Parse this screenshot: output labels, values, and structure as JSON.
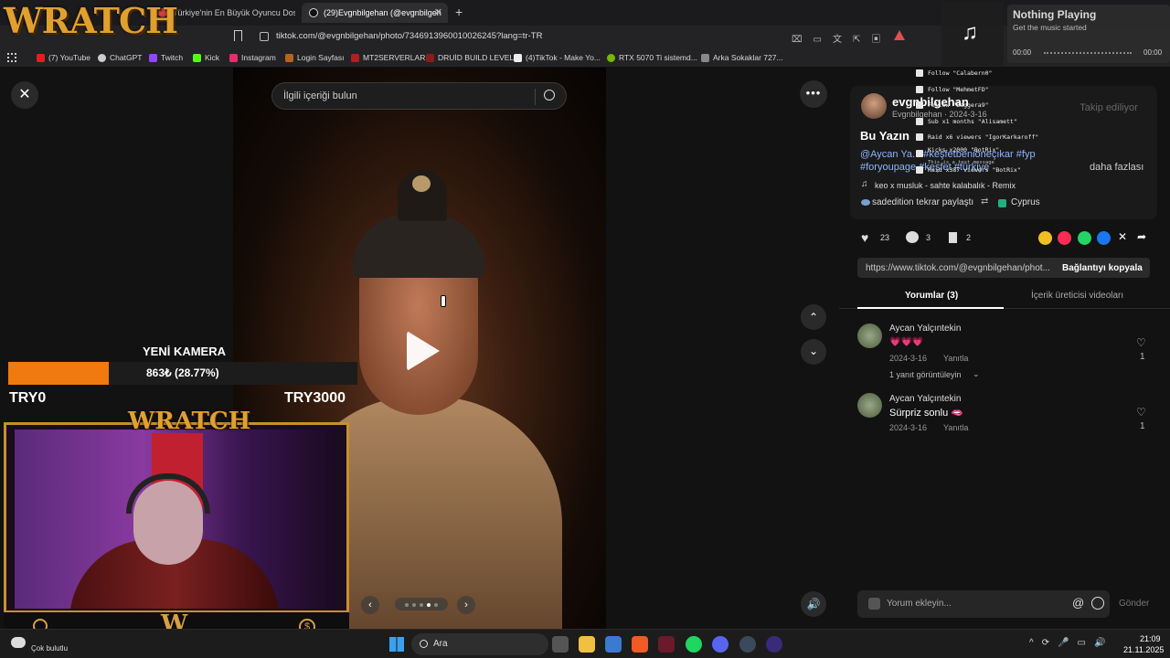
{
  "browser": {
    "tabs": [
      {
        "label": "Türkiye'nin En Büyük Oyuncu Dostu"
      },
      {
        "label": "(29)Evgnbilgehan (@evgnbilgeh"
      }
    ],
    "url": "tiktok.com/@evgnbilgehan/photo/7346913960010026245?lang=tr-TR",
    "bookmarks": [
      {
        "label": "(7) YouTube",
        "color": "#e02020"
      },
      {
        "label": "ChatGPT",
        "color": "#cccccc"
      },
      {
        "label": "Twitch",
        "color": "#9146ff"
      },
      {
        "label": "Kick",
        "color": "#53fc18"
      },
      {
        "label": "Instagram",
        "color": "#e1306c"
      },
      {
        "label": "Login Sayfası",
        "color": "#b8621e"
      },
      {
        "label": "MT2SERVERLAR",
        "color": "#b02020"
      },
      {
        "label": "DRUİD BUILD LEVEL",
        "color": "#8a1c1c"
      },
      {
        "label": "(4)TikTok - Make Yo...",
        "color": "#eeeeee"
      },
      {
        "label": "RTX 5070 Ti sistemd...",
        "color": "#76b900"
      },
      {
        "label": "Arka Sokaklar 727...",
        "color": "#888888"
      }
    ]
  },
  "music_widget": {
    "title": "Nothing Playing",
    "subtitle": "Get the music started",
    "time_start": "00:00",
    "time_end": "00:00"
  },
  "stream_overlay": {
    "brand": "WRATCH",
    "goal_title": "YENİ KAMERA",
    "goal_progress_text": "863₺ (28.77%)",
    "goal_progress_fraction": 0.2877,
    "goal_min": "TRY0",
    "goal_max": "TRY3000",
    "alerts": [
      {
        "text": "Follow \"Calabern0\""
      },
      {
        "text": "Follow \"MehmetFD\""
      },
      {
        "text": "Follow \"Baggera9\""
      },
      {
        "text": "Sub x1 months \"Alisamett\""
      },
      {
        "text": "Raid x6 viewers \"IgorKarkaroff\""
      },
      {
        "text": "Kicks x2000 \"BotRix\"",
        "sub": "This is a test message"
      },
      {
        "text": "Raid x387 viewers \"BotRix\""
      }
    ]
  },
  "tiktok": {
    "search_placeholder": "İlgili içeriği bulun",
    "author_name": "evgnbilgehan",
    "author_sub": "Evgnbilgehan · 2024-3-16",
    "follow_label": "Takip ediliyor",
    "caption_title": "Bu Yazın",
    "caption_mentions": "@Aycan Ya... #keşfetbeniöneçıkar #fyp",
    "caption_tags": "#foryoupage #keşfet #türkiye",
    "more_label": "daha fazlası",
    "music_line": "keo x musluk - sahte kalabalık - Remix",
    "repost_text": "sadedition tekrar paylaştı",
    "location": "Cyprus",
    "likes": "23",
    "comments": "3",
    "saves": "2",
    "share_url": "https://www.tiktok.com/@evgnbilgehan/phot...",
    "copy_link_label": "Bağlantıyı kopyala",
    "tab_comments": "Yorumlar (3)",
    "tab_creator": "İçerik üreticisi videoları",
    "comment_list": [
      {
        "author": "Aycan Yalçıntekin",
        "text": "💗💗💗",
        "date": "2024-3-16",
        "reply": "Yanıtla",
        "likes": "1",
        "view_replies": "1 yanıt görüntüleyin"
      },
      {
        "author": "Aycan Yalçıntekin",
        "text": "Sürpriz sonlu 🫦",
        "date": "2024-3-16",
        "reply": "Yanıtla",
        "likes": "1"
      }
    ],
    "comment_placeholder": "Yorum ekleyin...",
    "send_label": "Gönder"
  },
  "taskbar": {
    "search_label": "Ara",
    "time": "21:09",
    "date": "21.11.2025",
    "weather": "Çok bulutlu"
  }
}
